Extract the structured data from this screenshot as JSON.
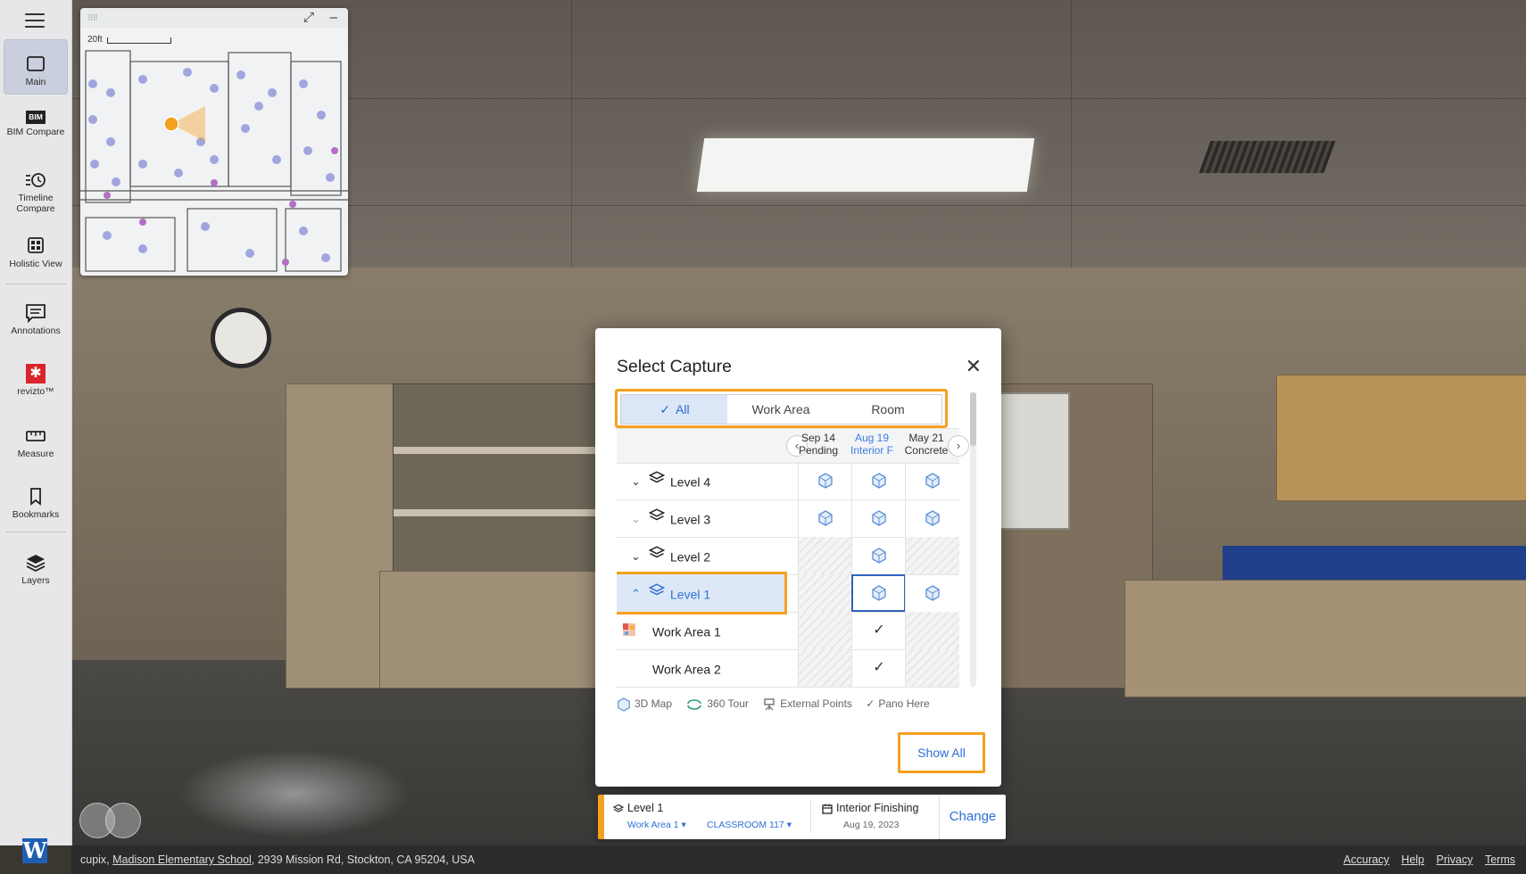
{
  "sidebar": {
    "items": [
      {
        "label": "Main",
        "icon": "square-icon"
      },
      {
        "label": "BIM Compare",
        "icon": "bim-icon",
        "badge": "BIM"
      },
      {
        "label": "Timeline Compare",
        "icon": "timeline-icon"
      },
      {
        "label": "Holistic View",
        "icon": "holistic-icon"
      },
      {
        "label": "Annotations",
        "icon": "annotation-icon"
      },
      {
        "label": "revizto™",
        "icon": "revizto-icon"
      },
      {
        "label": "Measure",
        "icon": "ruler-icon"
      },
      {
        "label": "Bookmarks",
        "icon": "bookmark-icon"
      },
      {
        "label": "Layers",
        "icon": "layers-icon"
      }
    ],
    "logo": "W"
  },
  "minimap": {
    "scale_label": "20ft"
  },
  "dialog": {
    "title": "Select Capture",
    "filters": [
      "All",
      "Work Area",
      "Room"
    ],
    "selected_filter": "All",
    "dates": [
      {
        "date": "Sep 14",
        "label": "Pending"
      },
      {
        "date": "Aug 19",
        "label": "Interior F"
      },
      {
        "date": "May 21",
        "label": "Concrete"
      }
    ],
    "rows": [
      {
        "label": "Level 4"
      },
      {
        "label": "Level 3"
      },
      {
        "label": "Level 2"
      },
      {
        "label": "Level 1"
      },
      {
        "label": "Work Area 1"
      },
      {
        "label": "Work Area 2"
      }
    ],
    "legend": [
      "3D Map",
      "360 Tour",
      "External Points",
      "Pano Here"
    ],
    "show_all": "Show All"
  },
  "bottombar": {
    "level": "Level 1",
    "work_area": "Work Area 1",
    "room": "CLASSROOM 117",
    "phase": "Interior Finishing",
    "date": "Aug 19, 2023",
    "change": "Change"
  },
  "footer": {
    "company": "cupix, ",
    "project": "Madison Elementary School",
    "address": ", 2939 Mission Rd, Stockton, CA 95204, USA",
    "links": [
      "Accuracy",
      "Help",
      "Privacy",
      "Terms"
    ]
  },
  "colors": {
    "accent": "#f4a020",
    "primary": "#2f6fd6",
    "sidebar_bg": "#e7e7e9"
  }
}
